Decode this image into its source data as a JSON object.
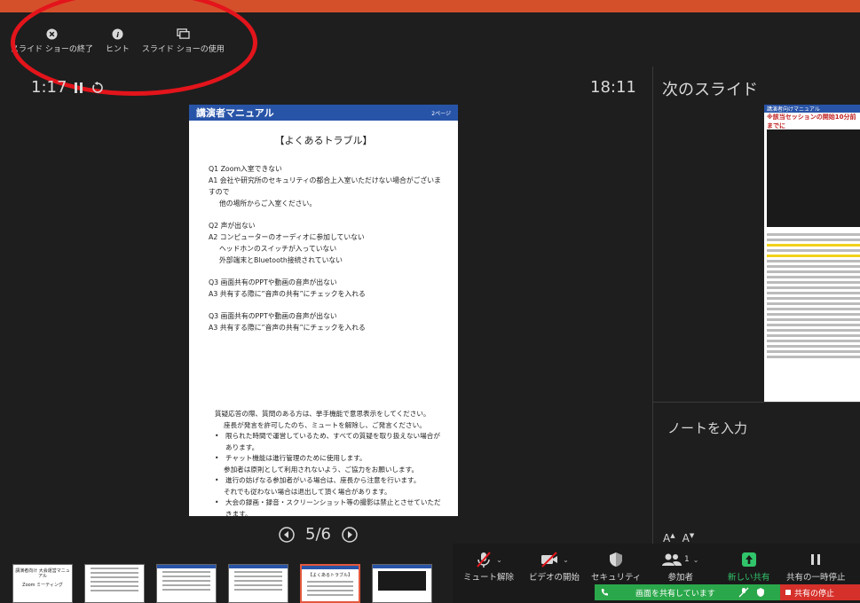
{
  "controls": {
    "end_show": "スライド ショーの終了",
    "hint": "ヒント",
    "use_show": "スライド ショーの使用"
  },
  "timer": {
    "elapsed": "1:17"
  },
  "clock": "18:11",
  "next_slide_label": "次のスライド",
  "slide": {
    "header_title": "講演者マニュアル",
    "page_tag": "2ページ",
    "title": "【よくあるトラブル】",
    "faq": [
      {
        "q": "Q1 Zoom入室できない",
        "a": "A1 会社や研究所のセキュリティの都合上入室いただけない場合がございますので",
        "a2": "他の場所からご入室ください。"
      },
      {
        "q": "Q2 声が出ない",
        "a": "A2 コンピューターのオーディオに参加していない",
        "a2": "ヘッドホンのスイッチが入っていない",
        "a3": "外部端末とBluetooth接続されていない"
      },
      {
        "q": "Q3 画面共有のPPTや動画の音声が出ない",
        "a": "A3 共有する際に”音声の共有”にチェックを入れる"
      },
      {
        "q": "Q3 画面共有のPPTや動画の音声が出ない",
        "a": "A3 共有する際に”音声の共有”にチェックを入れる"
      }
    ],
    "notes": {
      "line1": "質疑応答の際、質問のある方は、挙手機能で意思表示をしてください。",
      "line2": "座長が発言を許可したのち、ミュートを解除し、ご発言ください。",
      "b1": "限られた時間で運営しているため、すべての質疑を取り扱えない場合があります。",
      "b2": "チャット機能は進行管理のために使用します。",
      "b2b": "参加者は原則として利用されないよう、ご協力をお願いします。",
      "b3": "進行の妨げなる参加者がいる場合は、座長から注意を行います。",
      "b3b": "それでも従わない場合は退出して頂く場合があります。",
      "b4": "大会の録画・録音・スクリーンショット等の撮影は禁止とさせていただきます。"
    }
  },
  "next_slide": {
    "header": "講演者向けマニュアル",
    "subtitle": "※該当セッションの開始10分前までに"
  },
  "notes_placeholder": "ノートを入力",
  "pager": {
    "current": "5",
    "total": "6",
    "text": "5/6"
  },
  "font_buttons": {
    "increase": "A",
    "decrease": "A"
  },
  "thumbnails": [
    {
      "title": "講演者向け 大会運営マニュアル",
      "sub": "Zoom ミーティング",
      "selected": false
    },
    {
      "title": "",
      "selected": false
    },
    {
      "title": "",
      "selected": false
    },
    {
      "title": "",
      "selected": false
    },
    {
      "title": "【よくあるトラブル】",
      "selected": true
    },
    {
      "title": "",
      "selected": false
    }
  ],
  "zoom_toolbar": {
    "mute": "ミュート解除",
    "video": "ビデオの開始",
    "security": "セキュリティ",
    "participants": "参加者",
    "participants_count": "1",
    "new_share": "新しい共有",
    "pause_share": "共有の一時停止"
  },
  "share_status": "画面を共有しています",
  "stop_share": "共有の停止",
  "colors": {
    "accent": "#d4502b",
    "slide_blue": "#2854a8",
    "green": "#2aa74a",
    "red": "#d6302a"
  }
}
